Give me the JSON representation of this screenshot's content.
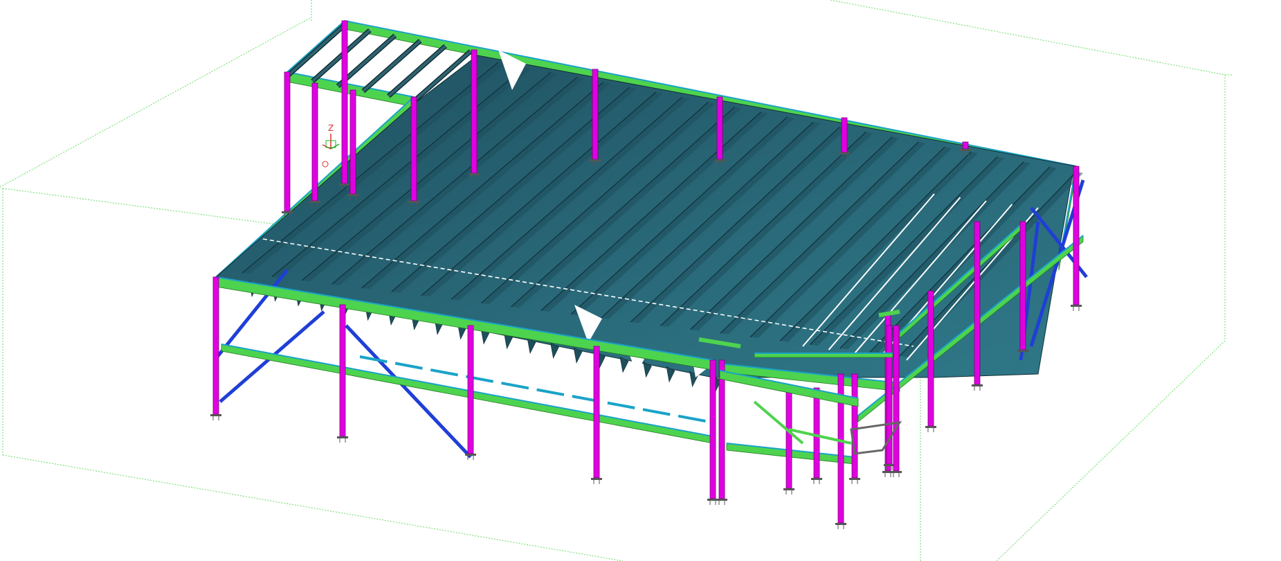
{
  "viewport": {
    "axis_label": "Z"
  },
  "colors": {
    "background": "#ffffff",
    "work_area_box": "#6fd86f",
    "column": "#e000e0",
    "column_edge": "#7a007a",
    "beam": "#4ed34e",
    "beam_edge": "#1f7a1f",
    "brace": "#1f3fd6",
    "deck": "#2a6878",
    "deck_dark": "#1d4f5c",
    "deck_edge": "#0f2e36",
    "edge_trim": "#1aa3c8",
    "baseplate": "#555555",
    "axis_x": "#e03030",
    "axis_y": "#20b020",
    "axis_z": "#e03030"
  },
  "icons": {
    "coordinate_axis": "xyz-axis-icon"
  }
}
